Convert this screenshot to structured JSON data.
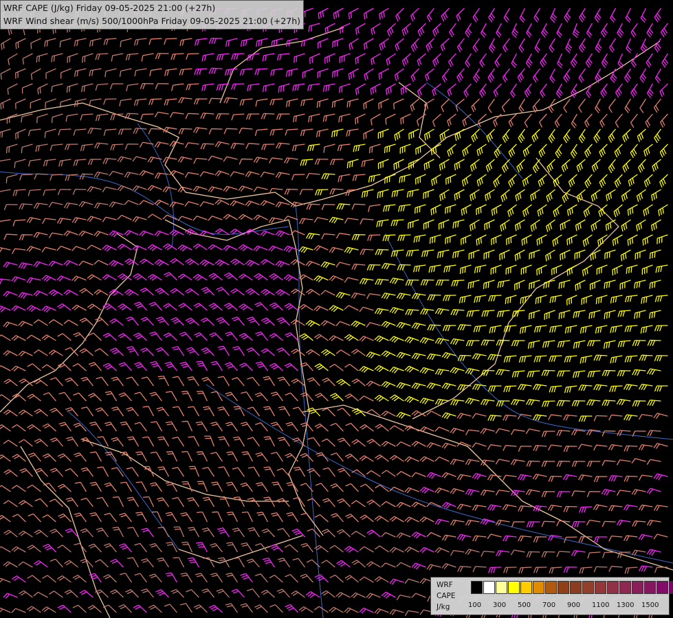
{
  "titles": {
    "line1": "WRF CAPE (J/kg) Friday 09-05-2025 21:00 (+27h)",
    "line2": "WRF Wind shear (m/s) 500/1000hPa Friday 09-05-2025 21:00 (+27h)"
  },
  "legend": {
    "model": "WRF",
    "field": "CAPE",
    "unit": "J/kg",
    "ticks": [
      "100",
      "300",
      "500",
      "700",
      "900",
      "1100",
      "1300",
      "1500"
    ],
    "colors": [
      "#000000",
      "#ffffff",
      "#ffff99",
      "#ffff00",
      "#ffcc00",
      "#e08a00",
      "#b05a10",
      "#8f4018",
      "#8a3d20",
      "#92402c",
      "#923838",
      "#923048",
      "#8e2850",
      "#8a1e58",
      "#861660",
      "#820c68",
      "#7e0070"
    ]
  },
  "barb_colors": {
    "magenta": "#ff22ff",
    "salmon": "#e8806e",
    "rose": "#c47a6e",
    "tan": "#c8a060",
    "yellow": "#ffff00",
    "grey": "#a09090"
  },
  "map_colors": {
    "border": "#f0c8a0",
    "river": "#3a6acc",
    "background": "#000000"
  }
}
